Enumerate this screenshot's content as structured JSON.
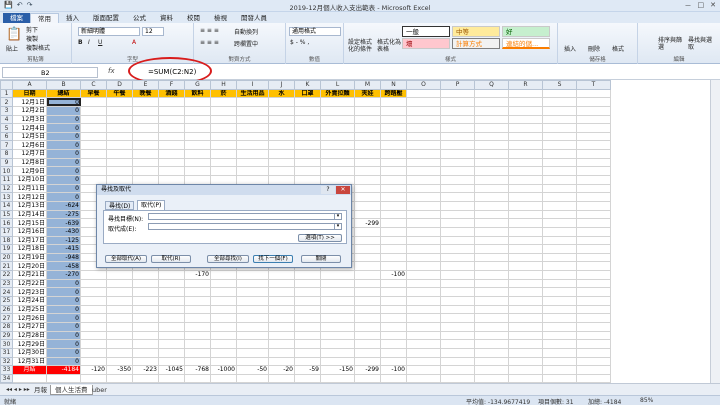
{
  "window": {
    "title": "2019-12月個人收入支出範表 - Microsoft Excel",
    "controls": [
      "－",
      "□",
      "✕"
    ]
  },
  "qat": [
    "💾",
    "↶",
    "↷"
  ],
  "tabs": [
    "檔案",
    "常用",
    "插入",
    "版面配置",
    "公式",
    "資料",
    "校閱",
    "檢視",
    "開發人員"
  ],
  "ribbon": {
    "clipboard": {
      "paste": "貼上",
      "cut": "剪下",
      "copy": "複製",
      "format_painter": "複製格式",
      "label": "剪貼簿"
    },
    "font": {
      "name": "新細明體",
      "size": "12",
      "label": "字型"
    },
    "alignment": {
      "wrap": "自動換列",
      "merge": "跨欄置中",
      "label": "對齊方式"
    },
    "number": {
      "format": "通用格式",
      "label": "數值"
    },
    "styles": {
      "conditional": "設定格式化的條件",
      "as_table": "格式化為表格",
      "label": "樣式",
      "items": [
        {
          "label": "一般"
        },
        {
          "label": "中等"
        },
        {
          "label": "好"
        },
        {
          "label": "壞"
        },
        {
          "label": "計算方式"
        },
        {
          "label": "連結的儲..."
        }
      ]
    },
    "cells": {
      "insert": "插入",
      "delete": "刪除",
      "format": "格式",
      "label": "儲存格"
    },
    "editing": {
      "sort": "排序與篩選",
      "find": "尋找與選取",
      "label": "編輯"
    }
  },
  "formula_bar": {
    "name_box": "B2",
    "fx": "fx",
    "formula": "=SUM(C2:N2)"
  },
  "columns": [
    "A",
    "B",
    "C",
    "D",
    "E",
    "F",
    "G",
    "H",
    "I",
    "J",
    "K",
    "L",
    "M",
    "N",
    "O",
    "P",
    "Q",
    "R",
    "S",
    "T"
  ],
  "headers": [
    "日期",
    "總結",
    "早餐",
    "午餐",
    "晚餐",
    "酒錢",
    "飲料",
    "菸",
    "生活用品",
    "水",
    "口罩",
    "外賣拉麵",
    "夾娃",
    "跨踏壓"
  ],
  "rows": [
    {
      "date": "12月1日",
      "total": "0",
      "cells": {}
    },
    {
      "date": "12月2日",
      "total": "0",
      "cells": {}
    },
    {
      "date": "12月3日",
      "total": "0",
      "cells": {}
    },
    {
      "date": "12月4日",
      "total": "0",
      "cells": {}
    },
    {
      "date": "12月5日",
      "total": "0",
      "cells": {}
    },
    {
      "date": "12月6日",
      "total": "0",
      "cells": {}
    },
    {
      "date": "12月7日",
      "total": "0",
      "cells": {}
    },
    {
      "date": "12月8日",
      "total": "0",
      "cells": {}
    },
    {
      "date": "12月9日",
      "total": "0",
      "cells": {}
    },
    {
      "date": "12月10日",
      "total": "0",
      "cells": {}
    },
    {
      "date": "12月11日",
      "total": "0",
      "cells": {}
    },
    {
      "date": "12月12日",
      "total": "0",
      "cells": {}
    },
    {
      "date": "12月13日",
      "total": "-624",
      "cells": {}
    },
    {
      "date": "12月14日",
      "total": "-275",
      "cells": {}
    },
    {
      "date": "12月15日",
      "total": "-639",
      "cells": {
        "12": "-299"
      }
    },
    {
      "date": "12月16日",
      "total": "-430",
      "cells": {}
    },
    {
      "date": "12月17日",
      "total": "-125",
      "cells": {}
    },
    {
      "date": "12月18日",
      "total": "-415",
      "cells": {}
    },
    {
      "date": "12月19日",
      "total": "-948",
      "cells": {}
    },
    {
      "date": "12月20日",
      "total": "-458",
      "cells": {}
    },
    {
      "date": "12月21日",
      "total": "-270",
      "cells": {
        "6": "-170",
        "13": "-100"
      }
    },
    {
      "date": "12月22日",
      "total": "0",
      "cells": {}
    },
    {
      "date": "12月23日",
      "total": "0",
      "cells": {}
    },
    {
      "date": "12月24日",
      "total": "0",
      "cells": {}
    },
    {
      "date": "12月25日",
      "total": "0",
      "cells": {}
    },
    {
      "date": "12月26日",
      "total": "0",
      "cells": {}
    },
    {
      "date": "12月27日",
      "total": "0",
      "cells": {}
    },
    {
      "date": "12月28日",
      "total": "0",
      "cells": {}
    },
    {
      "date": "12月29日",
      "total": "0",
      "cells": {}
    },
    {
      "date": "12月30日",
      "total": "0",
      "cells": {}
    },
    {
      "date": "12月31日",
      "total": "0",
      "cells": {}
    }
  ],
  "total_row": {
    "label": "月結",
    "total": "-4184",
    "values": [
      "-120",
      "-350",
      "-223",
      "-1045",
      "-768",
      "-1000",
      "-50",
      "-20",
      "-59",
      "-150",
      "-299",
      "-100"
    ]
  },
  "sheet_tabs": [
    "月報",
    "個人生活費",
    "uber"
  ],
  "status": {
    "left": "就緒",
    "average": "平均值: -134.9677419",
    "count": "項目個數: 31",
    "sum": "加總: -4184",
    "zoom": "85%"
  },
  "dialog": {
    "title": "尋找及取代",
    "tabs": [
      "尋找(D)",
      "取代(P)"
    ],
    "find_label": "尋找目標(N):",
    "replace_label": "取代成(E):",
    "options_button": "選項(T) >>",
    "buttons": [
      "全部取代(A)",
      "取代(R)",
      "全部尋找(I)",
      "找下一個(F)",
      "關閉"
    ]
  },
  "colors": {
    "header_fill": "#ffc000",
    "total_fill": "#ff0000",
    "balance_fill": "#95b3d7",
    "annotation": "#d81c1c"
  }
}
